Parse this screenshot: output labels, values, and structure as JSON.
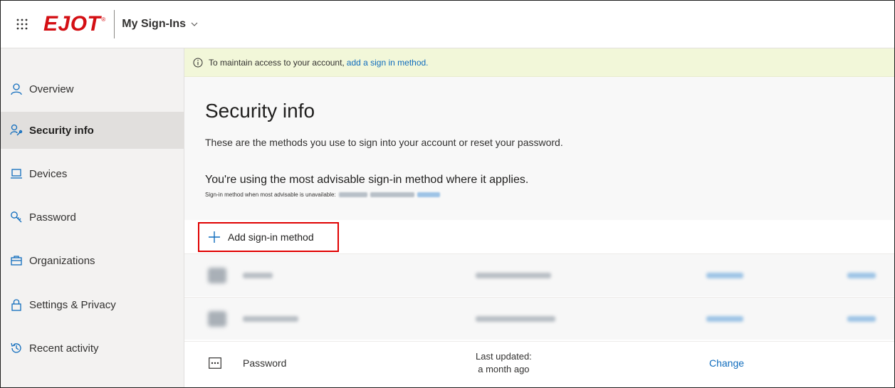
{
  "header": {
    "logo_text": "EJOT",
    "logo_mark": "®",
    "app_title": "My Sign-Ins",
    "waffle_icon": "waffle-icon",
    "chevron_icon": "chevron-down-icon"
  },
  "sidebar": {
    "items": [
      {
        "label": "Overview",
        "icon": "person-icon",
        "active": false
      },
      {
        "label": "Security info",
        "icon": "person-key-icon",
        "active": true
      },
      {
        "label": "Devices",
        "icon": "laptop-icon",
        "active": false
      },
      {
        "label": "Password",
        "icon": "key-icon",
        "active": false
      },
      {
        "label": "Organizations",
        "icon": "briefcase-icon",
        "active": false
      },
      {
        "label": "Settings & Privacy",
        "icon": "lock-icon",
        "active": false
      },
      {
        "label": "Recent activity",
        "icon": "history-icon",
        "active": false
      }
    ]
  },
  "banner": {
    "text": "To maintain access to your account,",
    "link": "add a sign in method."
  },
  "main": {
    "title": "Security info",
    "subtitle": "These are the methods you use to sign into your account or reset your password.",
    "advisable": "You're using the most advisable sign-in method where it applies.",
    "advisable_small": "Sign-in method when most advisable is unavailable:",
    "add_button": "Add sign-in method"
  },
  "methods": {
    "password_row": {
      "name": "Password",
      "updated_label": "Last updated:",
      "updated_value": "a month ago",
      "action": "Change"
    }
  },
  "colors": {
    "brand_red": "#d40f14",
    "link_blue": "#0f6cbd",
    "banner_bg": "#f2f7d9",
    "sidebar_bg": "#f3f2f1",
    "highlight_red": "#e00000"
  }
}
